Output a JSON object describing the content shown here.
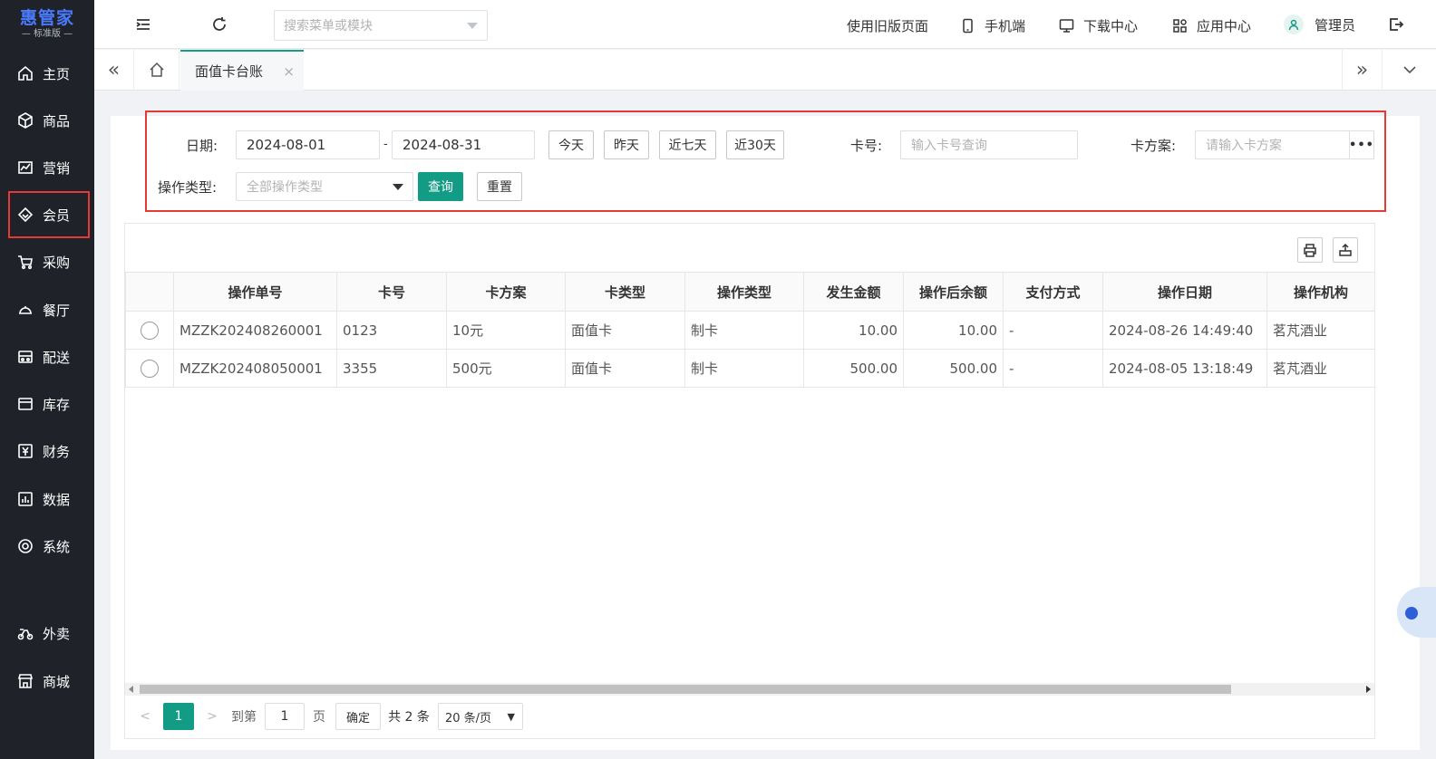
{
  "sidebar": {
    "logo": "惠管家",
    "edition": "— 标准版 —",
    "items": [
      {
        "label": "主页",
        "icon": "home-icon"
      },
      {
        "label": "商品",
        "icon": "cube-icon"
      },
      {
        "label": "营销",
        "icon": "trend-icon"
      },
      {
        "label": "会员",
        "icon": "diamond-icon"
      },
      {
        "label": "采购",
        "icon": "cart-icon"
      },
      {
        "label": "餐厅",
        "icon": "dish-icon"
      },
      {
        "label": "配送",
        "icon": "truck-icon"
      },
      {
        "label": "库存",
        "icon": "box-icon"
      },
      {
        "label": "财务",
        "icon": "yen-icon"
      },
      {
        "label": "数据",
        "icon": "chart-icon"
      },
      {
        "label": "系统",
        "icon": "gear-icon"
      },
      {
        "label": "外卖",
        "icon": "scooter-icon"
      },
      {
        "label": "商城",
        "icon": "store-icon"
      }
    ]
  },
  "header": {
    "search_placeholder": "搜索菜单或模块",
    "old_version": "使用旧版页面",
    "mobile": "手机端",
    "download": "下载中心",
    "apps": "应用中心",
    "user": "管理员"
  },
  "tabs": {
    "active_label": "面值卡台账",
    "close": "×"
  },
  "filter": {
    "date_label": "日期:",
    "date_start": "2024-08-01",
    "date_sep": "-",
    "date_end": "2024-08-31",
    "btn_today": "今天",
    "btn_yesterday": "昨天",
    "btn_7days": "近七天",
    "btn_30days": "近30天",
    "card_no_label": "卡号:",
    "card_no_placeholder": "输入卡号查询",
    "card_plan_label": "卡方案:",
    "card_plan_placeholder": "请输入卡方案",
    "more": "•••",
    "op_type_label": "操作类型:",
    "op_type_placeholder": "全部操作类型",
    "btn_query": "查询",
    "btn_reset": "重置"
  },
  "table": {
    "columns": [
      "",
      "操作单号",
      "卡号",
      "卡方案",
      "卡类型",
      "操作类型",
      "发生金额",
      "操作后余额",
      "支付方式",
      "操作日期",
      "操作机构"
    ],
    "rows": [
      [
        "",
        "MZZK202408260001",
        "0123",
        "10元",
        "面值卡",
        "制卡",
        "10.00",
        "10.00",
        "-",
        "2024-08-26 14:49:40",
        "茗芃酒业"
      ],
      [
        "",
        "MZZK202408050001",
        "3355",
        "500元",
        "面值卡",
        "制卡",
        "500.00",
        "500.00",
        "-",
        "2024-08-05 13:18:49",
        "茗芃酒业"
      ]
    ]
  },
  "pager": {
    "prev": "<",
    "current": "1",
    "next": ">",
    "goto_label": "到第",
    "goto_value": "1",
    "page_unit": "页",
    "confirm": "确定",
    "total": "共 2 条",
    "page_size": "20 条/页"
  },
  "colors": {
    "primary": "#129c86",
    "sidebar_bg": "#1f2329",
    "highlight_border": "#e53935",
    "logo": "#4a7bff"
  }
}
